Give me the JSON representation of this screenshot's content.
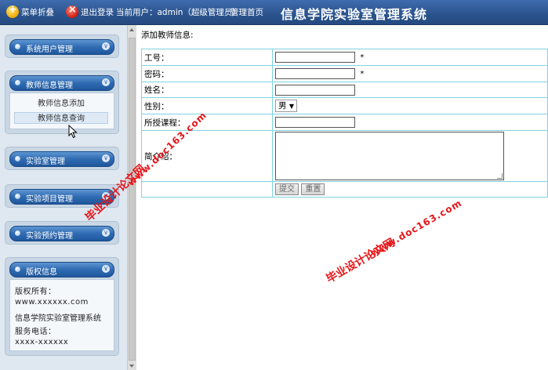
{
  "topbar": {
    "menu_fold": "菜单折叠",
    "logout": "退出登录",
    "current_user": "当前用户：admin（超级管理员）",
    "home": "管理首页",
    "system_title": "信息学院实验室管理系统"
  },
  "sidebar": {
    "panels": [
      {
        "label": "系统用户管理"
      },
      {
        "label": "教师信息管理",
        "items": [
          "教师信息添加",
          "教师信息查询"
        ]
      },
      {
        "label": "实验室管理"
      },
      {
        "label": "实验项目管理"
      },
      {
        "label": "实验预约管理"
      },
      {
        "label": "版权信息"
      }
    ],
    "copyright_lines": [
      "版权所有：",
      "www.xxxxxx.com",
      "信息学院实验室管理系统",
      "服务电话：",
      "xxxx-xxxxxx"
    ]
  },
  "main": {
    "title": "添加教师信息:",
    "fields": {
      "job_no": {
        "label": "工号：",
        "value": "",
        "required": "*"
      },
      "password": {
        "label": "密码：",
        "value": "",
        "required": "*"
      },
      "name": {
        "label": "姓名：",
        "value": ""
      },
      "gender": {
        "label": "性别：",
        "selected": "男"
      },
      "course": {
        "label": "所授课程：",
        "value": ""
      },
      "intro": {
        "label": "简介绍：",
        "value": ""
      }
    },
    "submit_label": "提交",
    "reset_label": "重置"
  },
  "watermarks": {
    "line1": "毕业设计论文网",
    "line2": "www.doc163.com"
  }
}
